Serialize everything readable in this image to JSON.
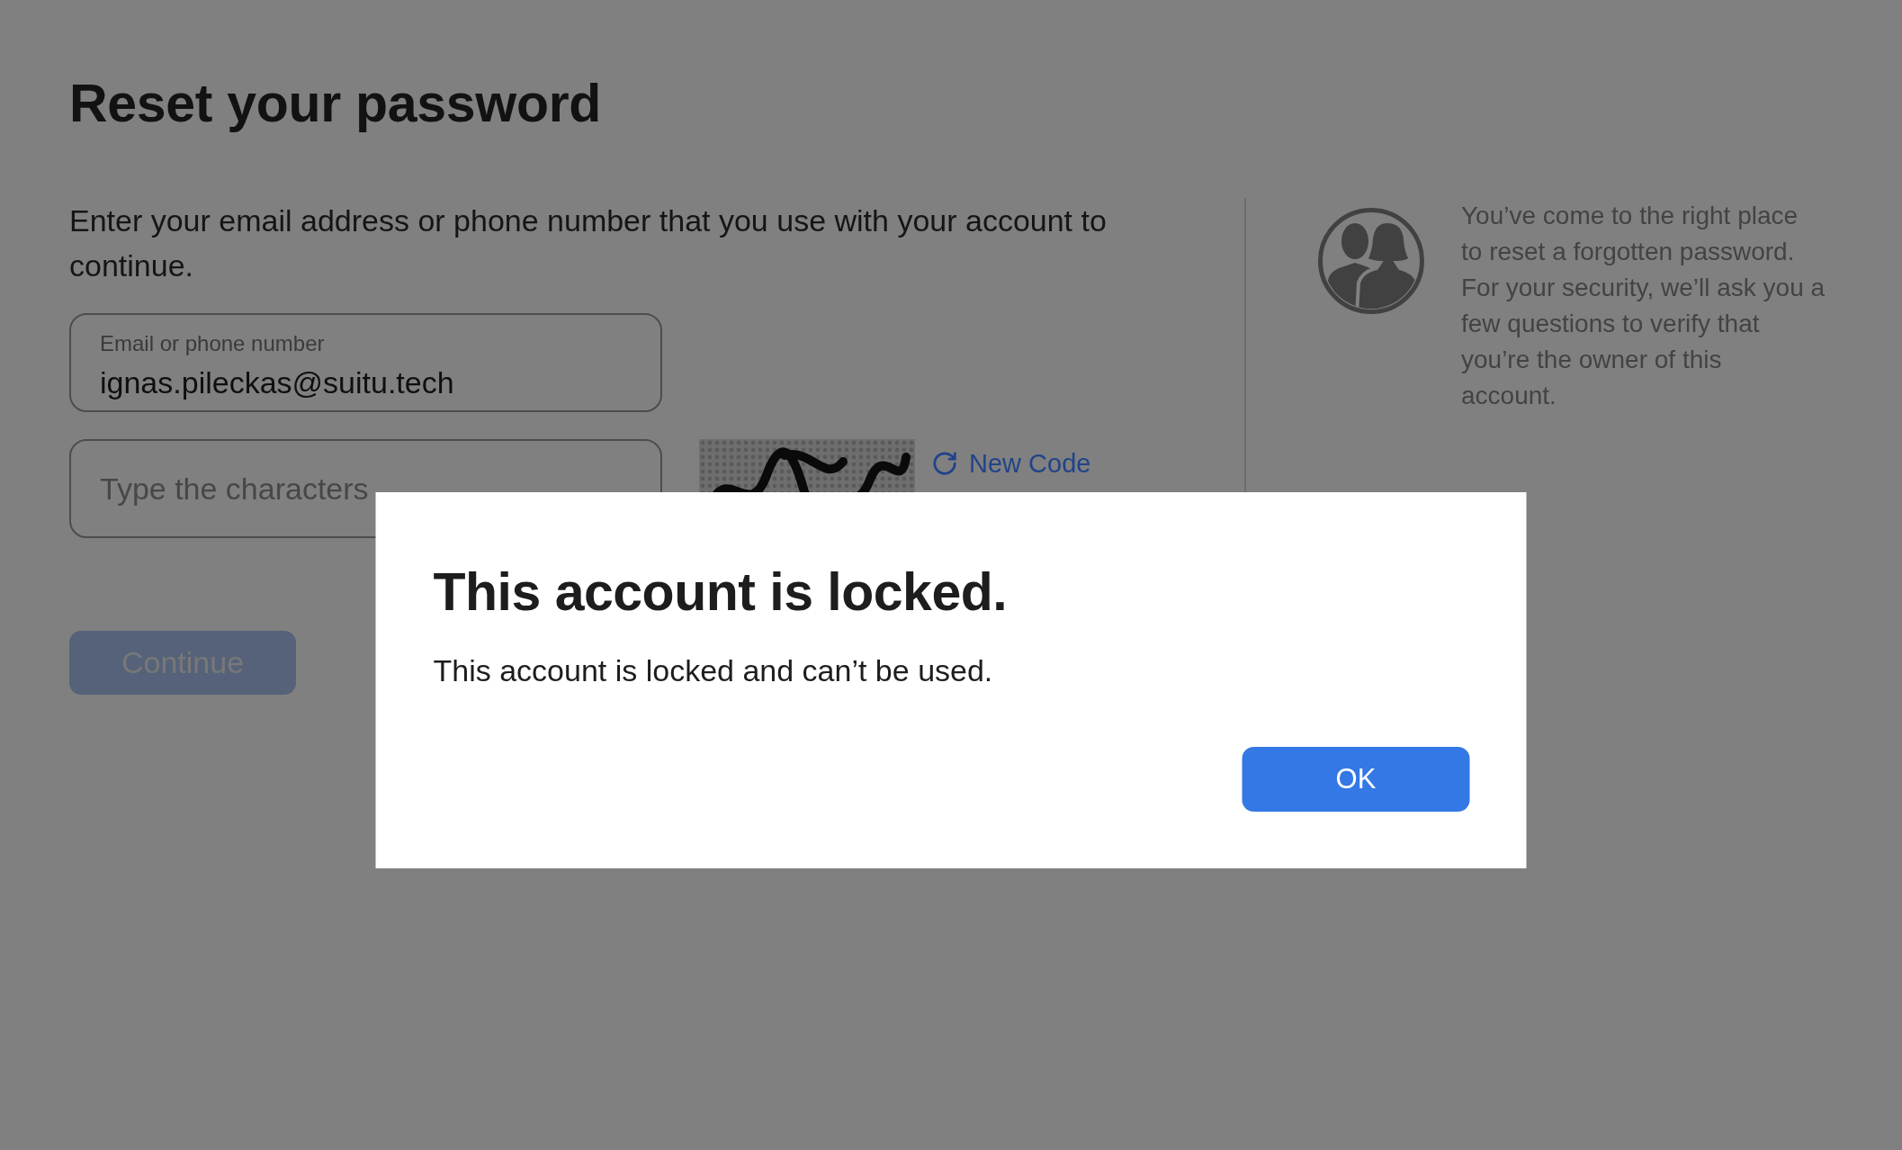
{
  "page": {
    "title": "Reset your password",
    "instructions": "Enter your email address or phone number that you use with your account to continue."
  },
  "form": {
    "email_field": {
      "label": "Email or phone number",
      "value": "ignas.pileckas@suitu.tech"
    },
    "captcha_field": {
      "placeholder": "Type the characters"
    },
    "new_code_link": "New Code",
    "continue_button": {
      "label": "Continue",
      "disabled": true
    }
  },
  "info_panel": {
    "text": "You’ve come to the right place\nto reset a forgotten password.\nFor your security, we’ll ask you a\nfew questions to verify that\nyou’re the owner of this\naccount."
  },
  "dialog": {
    "title": "This account is locked.",
    "message": "This account is locked and can’t be used.",
    "buttons": [
      {
        "label": "OK"
      }
    ]
  }
}
